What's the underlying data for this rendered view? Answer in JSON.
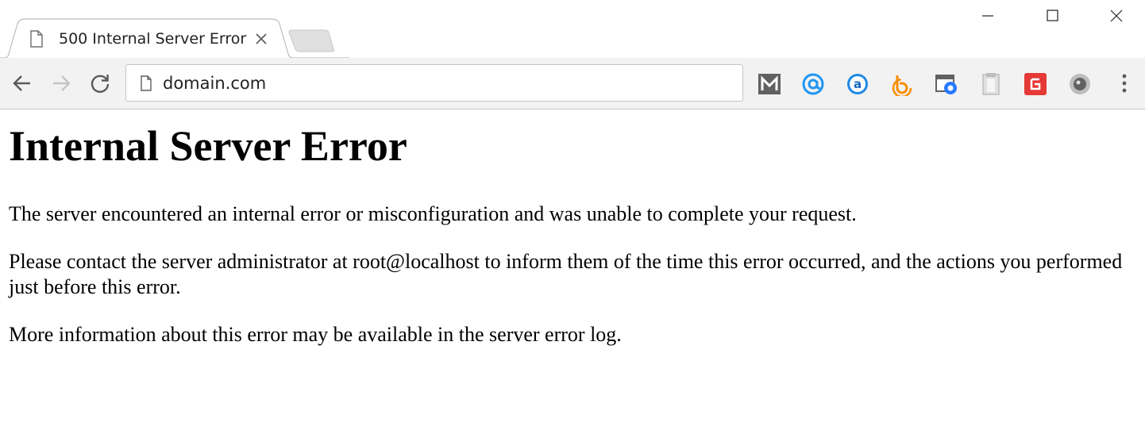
{
  "window": {
    "minimize_icon": "minimize-icon",
    "maximize_icon": "maximize-icon",
    "close_icon": "close-icon"
  },
  "tab": {
    "title": "500 Internal Server Error",
    "icon": "page-icon",
    "close_icon": "close-icon"
  },
  "toolbar": {
    "back_icon": "arrow-left-icon",
    "forward_icon": "arrow-right-icon",
    "reload_icon": "reload-icon",
    "address": "domain.com",
    "extensions": [
      {
        "name": "gmail-m-extension",
        "color": "#616161"
      },
      {
        "name": "at-sign-extension",
        "color": "#2196f3"
      },
      {
        "name": "amazon-assistant-extension",
        "color": "#1e88e5"
      },
      {
        "name": "b-circle-extension",
        "color": "#fb8c00"
      },
      {
        "name": "screenshot-extension",
        "color": "#2979ff"
      },
      {
        "name": "clipboard-extension",
        "color": "#bdbdbd"
      },
      {
        "name": "html-validator-extension",
        "color": "#e53935"
      },
      {
        "name": "camera-lens-extension",
        "color": "#9e9e9e"
      }
    ],
    "menu_icon": "three-dot-menu-icon"
  },
  "page": {
    "heading": "Internal Server Error",
    "paragraph1": "The server encountered an internal error or misconfiguration and was unable to complete your request.",
    "paragraph2": "Please contact the server administrator at root@localhost to inform them of the time this error occurred, and the actions you performed just before this error.",
    "paragraph3": "More information about this error may be available in the server error log."
  }
}
